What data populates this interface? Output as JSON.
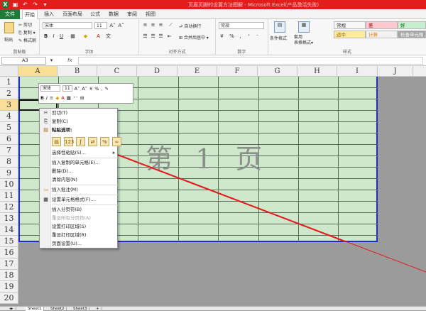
{
  "titlebar": {
    "title": "页眉页脚的设置方法图解 - Microsoft Excel(产品激活失败)"
  },
  "tabs": {
    "file": "文件",
    "items": [
      "开始",
      "插入",
      "页面布局",
      "公式",
      "数据",
      "审阅",
      "视图"
    ]
  },
  "ribbon": {
    "clipboard": {
      "paste": "粘贴",
      "cut": "剪切",
      "copy": "复制 ▾",
      "format_painter": "格式刷",
      "label": "剪贴板"
    },
    "font": {
      "name": "宋体",
      "size": "11",
      "label": "字体"
    },
    "alignment": {
      "wrap": "自动换行",
      "merge": "合并后居中 ▾",
      "label": "对齐方式"
    },
    "number": {
      "format": "常规",
      "label": "数字"
    },
    "styles": {
      "conditional": "条件格式",
      "table": "套用\n表格格式▾",
      "label": "样式",
      "cells": [
        {
          "text": "常规",
          "bg": "#ffffff",
          "fg": "#222222"
        },
        {
          "text": "差",
          "bg": "#ffc7ce",
          "fg": "#9c0006"
        },
        {
          "text": "好",
          "bg": "#c6efce",
          "fg": "#006100"
        },
        {
          "text": "适中",
          "bg": "#ffeb9c",
          "fg": "#9c5700"
        },
        {
          "text": "计算",
          "bg": "#f2f2f2",
          "fg": "#fa7d00"
        },
        {
          "text": "检查单元格",
          "bg": "#a5a5a5",
          "fg": "#ffffff"
        }
      ]
    }
  },
  "formulabar": {
    "namebox": "A3",
    "fx": "fx"
  },
  "grid": {
    "columns": [
      "A",
      "B",
      "C",
      "D",
      "E",
      "F",
      "G",
      "H",
      "I",
      "J"
    ],
    "selected_column": "A",
    "rows": [
      "1",
      "2",
      "3",
      "4",
      "5",
      "6",
      "7",
      "8",
      "9",
      "10",
      "11",
      "12",
      "13",
      "14",
      "15",
      "16",
      "17",
      "18",
      "19",
      "20"
    ],
    "selected_row": "3",
    "watermark": "第 1 页"
  },
  "minitoolbar": {
    "font": "宋体",
    "size": "11",
    "percent": "%"
  },
  "context_menu": {
    "items": [
      {
        "label": "剪切(T)",
        "icon": "scissors-icon",
        "disabled": false
      },
      {
        "label": "复制(C)",
        "icon": "copy-icon",
        "disabled": false
      },
      {
        "label": "粘贴选项:",
        "icon": "paste-icon",
        "disabled": false,
        "bold": true
      },
      {
        "label": "选择性粘贴(S)...",
        "icon": "",
        "disabled": false
      },
      {
        "label": "插入复制的单元格(E)...",
        "icon": "",
        "disabled": false
      },
      {
        "label": "删除(D)...",
        "icon": "",
        "disabled": false
      },
      {
        "label": "清除内容(N)",
        "icon": "",
        "disabled": false
      },
      {
        "label": "插入批注(M)",
        "icon": "comment-icon",
        "disabled": false
      },
      {
        "label": "设置单元格格式(F)...",
        "icon": "format-icon",
        "disabled": false
      },
      {
        "label": "插入分页符(B)",
        "icon": "",
        "disabled": false
      },
      {
        "label": "重设所有分页符(A)",
        "icon": "",
        "disabled": true
      },
      {
        "label": "设置打印区域(S)",
        "icon": "",
        "disabled": false
      },
      {
        "label": "重设打印区域(R)",
        "icon": "",
        "disabled": false
      },
      {
        "label": "页面设置(U)...",
        "icon": "",
        "disabled": false
      }
    ]
  },
  "sheets": [
    "Sheet1",
    "Sheet2",
    "Sheet3"
  ],
  "colors": {
    "title_red": "#e31c1c",
    "file_green": "#1e7c3a",
    "page_green": "#cfe8cc",
    "page_border": "#1b2fc7",
    "arrow_red": "#e02020"
  }
}
